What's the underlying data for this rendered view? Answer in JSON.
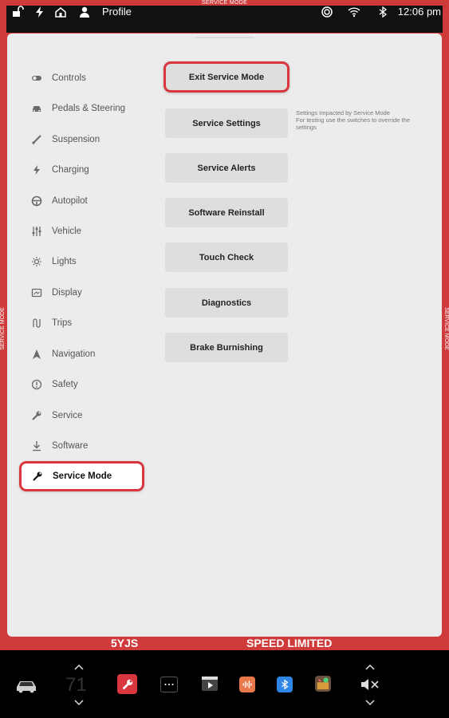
{
  "banner": {
    "service_mode_top": "SERVICE MODE",
    "service_mode_left": "SERVICE MODE",
    "service_mode_right": "SERVICE MODE",
    "bottom_id": "5YJS",
    "bottom_status": "SPEED LIMITED"
  },
  "status_bar": {
    "profile_label": "Profile",
    "time": "12:06 pm"
  },
  "sidebar": {
    "items": [
      {
        "label": "Controls",
        "icon": "toggle-icon"
      },
      {
        "label": "Pedals & Steering",
        "icon": "car-icon"
      },
      {
        "label": "Suspension",
        "icon": "suspension-icon"
      },
      {
        "label": "Charging",
        "icon": "lightning-icon"
      },
      {
        "label": "Autopilot",
        "icon": "steering-wheel-icon"
      },
      {
        "label": "Vehicle",
        "icon": "sliders-icon"
      },
      {
        "label": "Lights",
        "icon": "sun-icon"
      },
      {
        "label": "Display",
        "icon": "display-icon"
      },
      {
        "label": "Trips",
        "icon": "trips-icon"
      },
      {
        "label": "Navigation",
        "icon": "navigation-icon"
      },
      {
        "label": "Safety",
        "icon": "alert-circle-icon"
      },
      {
        "label": "Service",
        "icon": "wrench-icon"
      },
      {
        "label": "Software",
        "icon": "download-icon"
      },
      {
        "label": "Service Mode",
        "icon": "wrench-icon",
        "active": true
      }
    ]
  },
  "main": {
    "buttons": [
      {
        "label": "Exit Service Mode"
      },
      {
        "label": "Service Settings"
      },
      {
        "label": "Service Alerts"
      },
      {
        "label": "Software Reinstall"
      },
      {
        "label": "Touch Check"
      },
      {
        "label": "Diagnostics"
      },
      {
        "label": "Brake Burnishing"
      }
    ],
    "note_line1": "Settings Impacted by Service Mode",
    "note_line2": "For testing use the switches to override the settings"
  },
  "dock": {
    "temperature": "71",
    "apps": [
      "car-icon",
      "service-wrench-app-icon",
      "more-icon",
      "video-app-icon",
      "audio-app-icon",
      "bluetooth-app-icon",
      "toybox-app-icon",
      "mute-volume-icon"
    ]
  },
  "colors": {
    "accent_red": "#d9363e",
    "frame_red": "#cf3b3b",
    "panel_bg": "#ececec",
    "button_bg": "#dedede"
  }
}
